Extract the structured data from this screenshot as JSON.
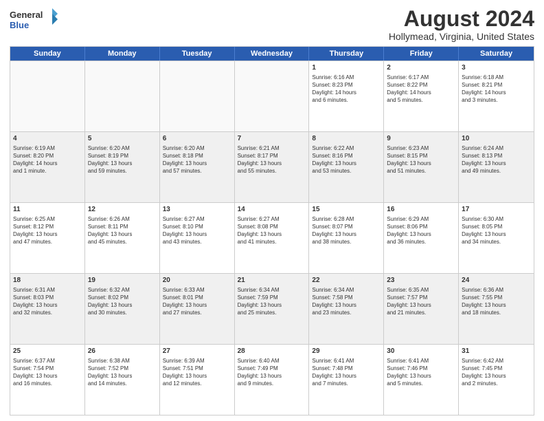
{
  "header": {
    "logo": {
      "line1": "General",
      "line2": "Blue"
    },
    "title": "August 2024",
    "subtitle": "Hollymead, Virginia, United States"
  },
  "calendar": {
    "days": [
      "Sunday",
      "Monday",
      "Tuesday",
      "Wednesday",
      "Thursday",
      "Friday",
      "Saturday"
    ],
    "rows": [
      [
        {
          "day": "",
          "empty": true
        },
        {
          "day": "",
          "empty": true
        },
        {
          "day": "",
          "empty": true
        },
        {
          "day": "",
          "empty": true
        },
        {
          "day": "1",
          "lines": [
            "Sunrise: 6:16 AM",
            "Sunset: 8:23 PM",
            "Daylight: 14 hours",
            "and 6 minutes."
          ]
        },
        {
          "day": "2",
          "lines": [
            "Sunrise: 6:17 AM",
            "Sunset: 8:22 PM",
            "Daylight: 14 hours",
            "and 5 minutes."
          ]
        },
        {
          "day": "3",
          "lines": [
            "Sunrise: 6:18 AM",
            "Sunset: 8:21 PM",
            "Daylight: 14 hours",
            "and 3 minutes."
          ]
        }
      ],
      [
        {
          "day": "4",
          "shaded": true,
          "lines": [
            "Sunrise: 6:19 AM",
            "Sunset: 8:20 PM",
            "Daylight: 14 hours",
            "and 1 minute."
          ]
        },
        {
          "day": "5",
          "shaded": true,
          "lines": [
            "Sunrise: 6:20 AM",
            "Sunset: 8:19 PM",
            "Daylight: 13 hours",
            "and 59 minutes."
          ]
        },
        {
          "day": "6",
          "shaded": true,
          "lines": [
            "Sunrise: 6:20 AM",
            "Sunset: 8:18 PM",
            "Daylight: 13 hours",
            "and 57 minutes."
          ]
        },
        {
          "day": "7",
          "shaded": true,
          "lines": [
            "Sunrise: 6:21 AM",
            "Sunset: 8:17 PM",
            "Daylight: 13 hours",
            "and 55 minutes."
          ]
        },
        {
          "day": "8",
          "shaded": true,
          "lines": [
            "Sunrise: 6:22 AM",
            "Sunset: 8:16 PM",
            "Daylight: 13 hours",
            "and 53 minutes."
          ]
        },
        {
          "day": "9",
          "shaded": true,
          "lines": [
            "Sunrise: 6:23 AM",
            "Sunset: 8:15 PM",
            "Daylight: 13 hours",
            "and 51 minutes."
          ]
        },
        {
          "day": "10",
          "shaded": true,
          "lines": [
            "Sunrise: 6:24 AM",
            "Sunset: 8:13 PM",
            "Daylight: 13 hours",
            "and 49 minutes."
          ]
        }
      ],
      [
        {
          "day": "11",
          "lines": [
            "Sunrise: 6:25 AM",
            "Sunset: 8:12 PM",
            "Daylight: 13 hours",
            "and 47 minutes."
          ]
        },
        {
          "day": "12",
          "lines": [
            "Sunrise: 6:26 AM",
            "Sunset: 8:11 PM",
            "Daylight: 13 hours",
            "and 45 minutes."
          ]
        },
        {
          "day": "13",
          "lines": [
            "Sunrise: 6:27 AM",
            "Sunset: 8:10 PM",
            "Daylight: 13 hours",
            "and 43 minutes."
          ]
        },
        {
          "day": "14",
          "lines": [
            "Sunrise: 6:27 AM",
            "Sunset: 8:08 PM",
            "Daylight: 13 hours",
            "and 41 minutes."
          ]
        },
        {
          "day": "15",
          "lines": [
            "Sunrise: 6:28 AM",
            "Sunset: 8:07 PM",
            "Daylight: 13 hours",
            "and 38 minutes."
          ]
        },
        {
          "day": "16",
          "lines": [
            "Sunrise: 6:29 AM",
            "Sunset: 8:06 PM",
            "Daylight: 13 hours",
            "and 36 minutes."
          ]
        },
        {
          "day": "17",
          "lines": [
            "Sunrise: 6:30 AM",
            "Sunset: 8:05 PM",
            "Daylight: 13 hours",
            "and 34 minutes."
          ]
        }
      ],
      [
        {
          "day": "18",
          "shaded": true,
          "lines": [
            "Sunrise: 6:31 AM",
            "Sunset: 8:03 PM",
            "Daylight: 13 hours",
            "and 32 minutes."
          ]
        },
        {
          "day": "19",
          "shaded": true,
          "lines": [
            "Sunrise: 6:32 AM",
            "Sunset: 8:02 PM",
            "Daylight: 13 hours",
            "and 30 minutes."
          ]
        },
        {
          "day": "20",
          "shaded": true,
          "lines": [
            "Sunrise: 6:33 AM",
            "Sunset: 8:01 PM",
            "Daylight: 13 hours",
            "and 27 minutes."
          ]
        },
        {
          "day": "21",
          "shaded": true,
          "lines": [
            "Sunrise: 6:34 AM",
            "Sunset: 7:59 PM",
            "Daylight: 13 hours",
            "and 25 minutes."
          ]
        },
        {
          "day": "22",
          "shaded": true,
          "lines": [
            "Sunrise: 6:34 AM",
            "Sunset: 7:58 PM",
            "Daylight: 13 hours",
            "and 23 minutes."
          ]
        },
        {
          "day": "23",
          "shaded": true,
          "lines": [
            "Sunrise: 6:35 AM",
            "Sunset: 7:57 PM",
            "Daylight: 13 hours",
            "and 21 minutes."
          ]
        },
        {
          "day": "24",
          "shaded": true,
          "lines": [
            "Sunrise: 6:36 AM",
            "Sunset: 7:55 PM",
            "Daylight: 13 hours",
            "and 18 minutes."
          ]
        }
      ],
      [
        {
          "day": "25",
          "lines": [
            "Sunrise: 6:37 AM",
            "Sunset: 7:54 PM",
            "Daylight: 13 hours",
            "and 16 minutes."
          ]
        },
        {
          "day": "26",
          "lines": [
            "Sunrise: 6:38 AM",
            "Sunset: 7:52 PM",
            "Daylight: 13 hours",
            "and 14 minutes."
          ]
        },
        {
          "day": "27",
          "lines": [
            "Sunrise: 6:39 AM",
            "Sunset: 7:51 PM",
            "Daylight: 13 hours",
            "and 12 minutes."
          ]
        },
        {
          "day": "28",
          "lines": [
            "Sunrise: 6:40 AM",
            "Sunset: 7:49 PM",
            "Daylight: 13 hours",
            "and 9 minutes."
          ]
        },
        {
          "day": "29",
          "lines": [
            "Sunrise: 6:41 AM",
            "Sunset: 7:48 PM",
            "Daylight: 13 hours",
            "and 7 minutes."
          ]
        },
        {
          "day": "30",
          "lines": [
            "Sunrise: 6:41 AM",
            "Sunset: 7:46 PM",
            "Daylight: 13 hours",
            "and 5 minutes."
          ]
        },
        {
          "day": "31",
          "lines": [
            "Sunrise: 6:42 AM",
            "Sunset: 7:45 PM",
            "Daylight: 13 hours",
            "and 2 minutes."
          ]
        }
      ]
    ]
  }
}
